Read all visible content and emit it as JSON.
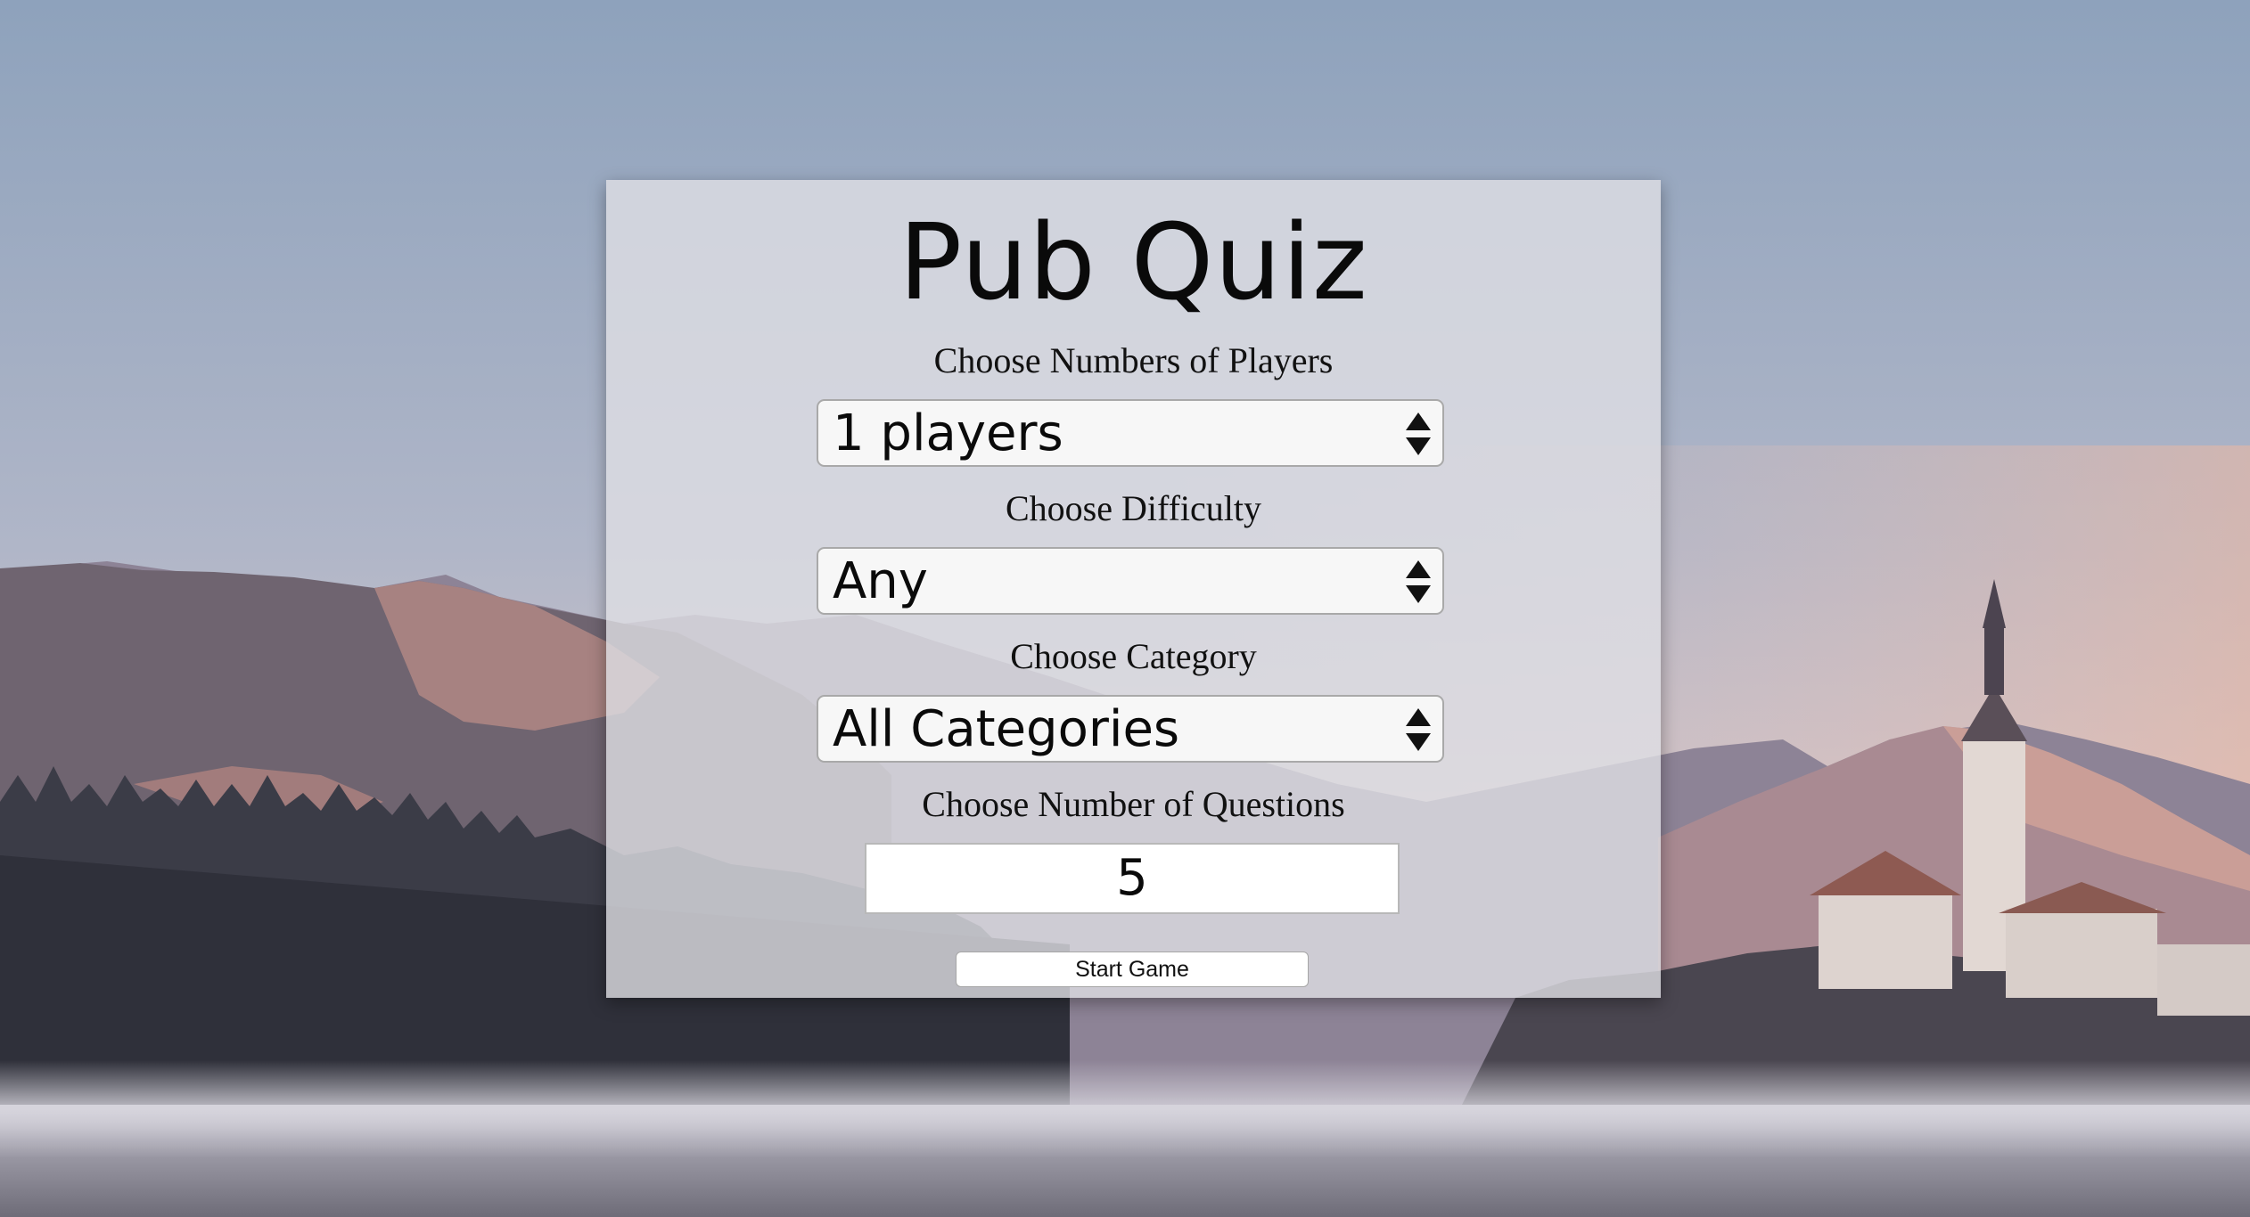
{
  "quiz": {
    "title": "Pub Quiz",
    "players": {
      "label": "Choose Numbers of Players",
      "selected": "1 players"
    },
    "difficulty": {
      "label": "Choose Difficulty",
      "selected": "Any"
    },
    "category": {
      "label": "Choose Category",
      "selected": "All Categories"
    },
    "questions": {
      "label": "Choose Number of Questions",
      "value": "5"
    },
    "start_label": "Start Game"
  },
  "icons": {
    "select_arrows": "up-down-arrows-icon"
  },
  "colors": {
    "panel_background": "#dedee4",
    "sky_top": "#8fa3bd",
    "sky_bottom": "#e0c9c6",
    "text": "#0a0a0a"
  }
}
